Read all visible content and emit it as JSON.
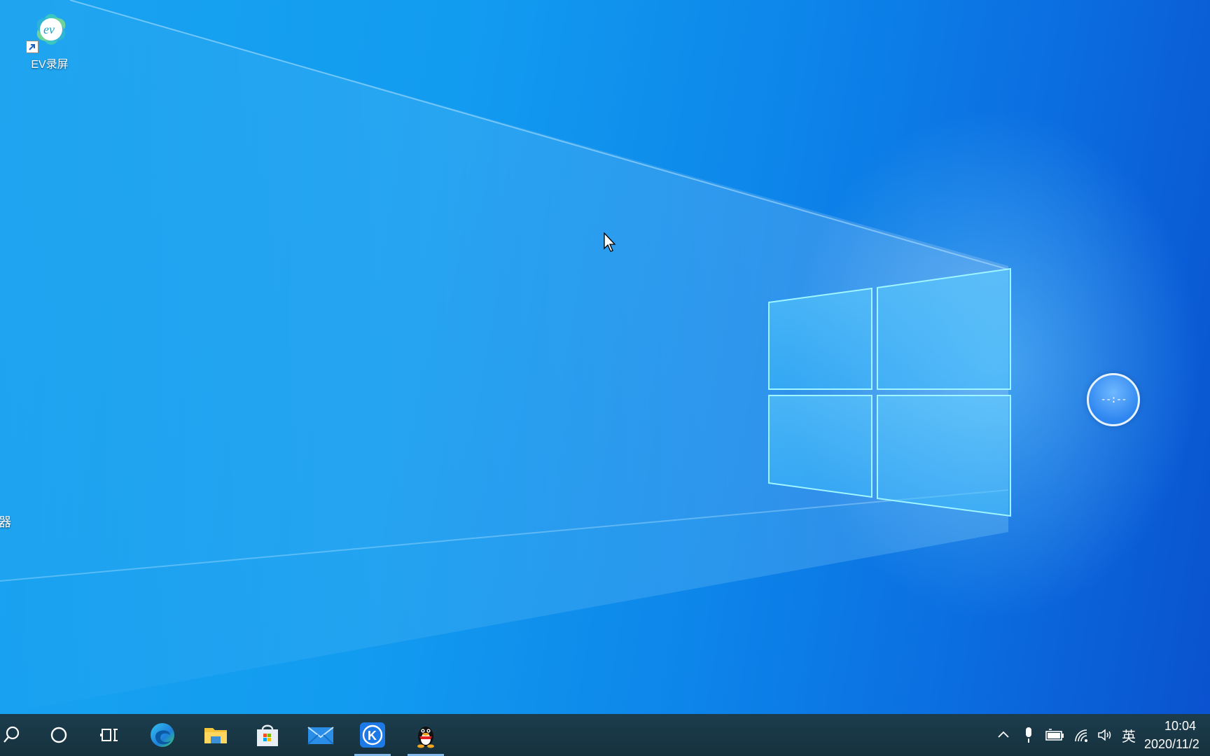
{
  "desktop": {
    "icons": [
      {
        "label": "EV录屏",
        "icon": "ev-recorder-icon"
      }
    ],
    "partial_label": "器",
    "float_widget_text": "--:--"
  },
  "taskbar": {
    "search": {
      "icon": "search-icon"
    },
    "cortana": {
      "icon": "cortana-circle-icon"
    },
    "task_view": {
      "icon": "task-view-icon"
    },
    "apps": [
      {
        "name": "Microsoft Edge",
        "icon": "edge-icon",
        "active": false
      },
      {
        "name": "File Explorer",
        "icon": "folder-icon",
        "active": false
      },
      {
        "name": "Microsoft Store",
        "icon": "store-icon",
        "active": false
      },
      {
        "name": "Mail",
        "icon": "mail-icon",
        "active": false
      },
      {
        "name": "Kugou",
        "icon": "kugou-k-icon",
        "active": true
      },
      {
        "name": "QQ",
        "icon": "qq-penguin-icon",
        "active": true
      }
    ],
    "tray": {
      "chevron": "chevron-up-icon",
      "mic": "microphone-icon",
      "battery": "battery-icon",
      "network": "wifi-icon",
      "volume": "volume-icon",
      "ime_label": "英"
    },
    "clock": {
      "time": "10:04",
      "date": "2020/11/2"
    }
  },
  "colors": {
    "taskbar_bg": "#1a3a4a",
    "accent": "#0a78e6",
    "active_indicator": "#7fb8e8"
  }
}
